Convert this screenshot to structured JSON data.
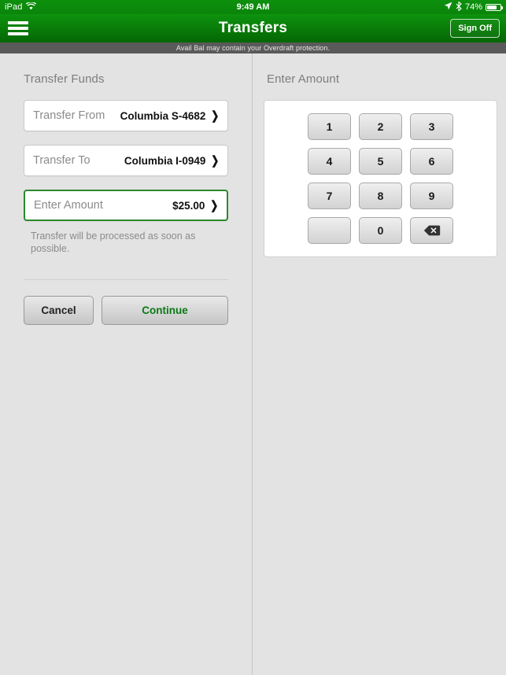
{
  "status_bar": {
    "device": "iPad",
    "wifi_icon": "wifi-icon",
    "time": "9:49 AM",
    "location_icon": "location-arrow-icon",
    "bluetooth_icon": "bluetooth-icon",
    "battery_percent": "74%",
    "battery_level": 74
  },
  "nav": {
    "menu_icon": "hamburger-menu-icon",
    "title": "Transfers",
    "sign_off_label": "Sign Off"
  },
  "alert": {
    "message": "Avail Bal may contain your Overdraft protection."
  },
  "transfer_panel": {
    "title": "Transfer Funds",
    "fields": [
      {
        "label": "Transfer From",
        "value": "Columbia S-4682",
        "chevron": "chevron-right-icon",
        "active": false
      },
      {
        "label": "Transfer To",
        "value": "Columbia I-0949",
        "chevron": "chevron-right-icon",
        "active": false
      },
      {
        "label": "Enter Amount",
        "value": "$25.00",
        "chevron": "chevron-right-icon",
        "active": true
      }
    ],
    "helper_text": "Transfer will be processed as soon as possible.",
    "cancel_label": "Cancel",
    "continue_label": "Continue"
  },
  "amount_panel": {
    "title": "Enter Amount",
    "keypad_rows": [
      [
        "1",
        "2",
        "3"
      ],
      [
        "4",
        "5",
        "6"
      ],
      [
        "7",
        "8",
        "9"
      ],
      [
        "",
        "0",
        "backspace"
      ]
    ],
    "backspace_icon": "backspace-delete-icon"
  },
  "colors": {
    "brand_green": "#0a8a0a",
    "nav_green_top": "#0e930e",
    "nav_green_bottom": "#046604",
    "continue_green": "#0a7a14",
    "active_border_green": "#2a8a2a",
    "alert_gray": "#5a5a5a",
    "page_bg": "#e3e3e3"
  }
}
